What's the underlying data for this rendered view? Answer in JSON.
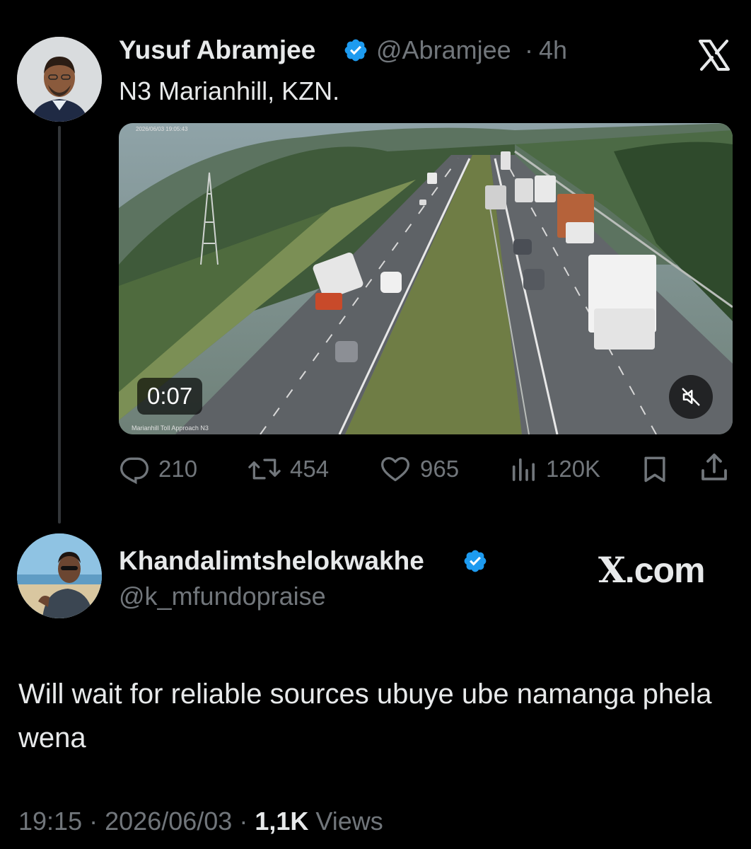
{
  "tweet": {
    "author_name": "Yusuf Abramjee",
    "handle": "@Abramjee",
    "separator": "·",
    "time_ago": "4h",
    "text": "N3 Marianhill, KZN.",
    "video": {
      "duration": "0:07",
      "camera_label": "Marianhill Toll Approach N3",
      "stamp": "2026/06/03 19:05:43"
    },
    "stats": {
      "replies": "210",
      "reposts": "454",
      "likes": "965",
      "views": "120K"
    }
  },
  "reply": {
    "author_name": "Khandalimtshelokwakhe",
    "handle": "@k_mfundopraise",
    "text": "Will wait for reliable sources ubuye ube namanga phela wena",
    "time": "19:15",
    "separator": "·",
    "date": "2026/06/03",
    "views_count": "1,1K",
    "views_label": "Views"
  },
  "watermark": {
    "domain": ".com"
  },
  "icons": {
    "verified": "verified-badge-icon",
    "x_logo": "x-logo-icon",
    "reply": "reply-icon",
    "repost": "repost-icon",
    "like": "heart-icon",
    "views": "views-icon",
    "bookmark": "bookmark-icon",
    "share": "share-icon",
    "mute": "muted-speaker-icon"
  },
  "colors": {
    "background": "#000000",
    "primary_text": "#e7e9ea",
    "secondary_text": "#71767b",
    "verified_blue": "#1d9bf0"
  }
}
